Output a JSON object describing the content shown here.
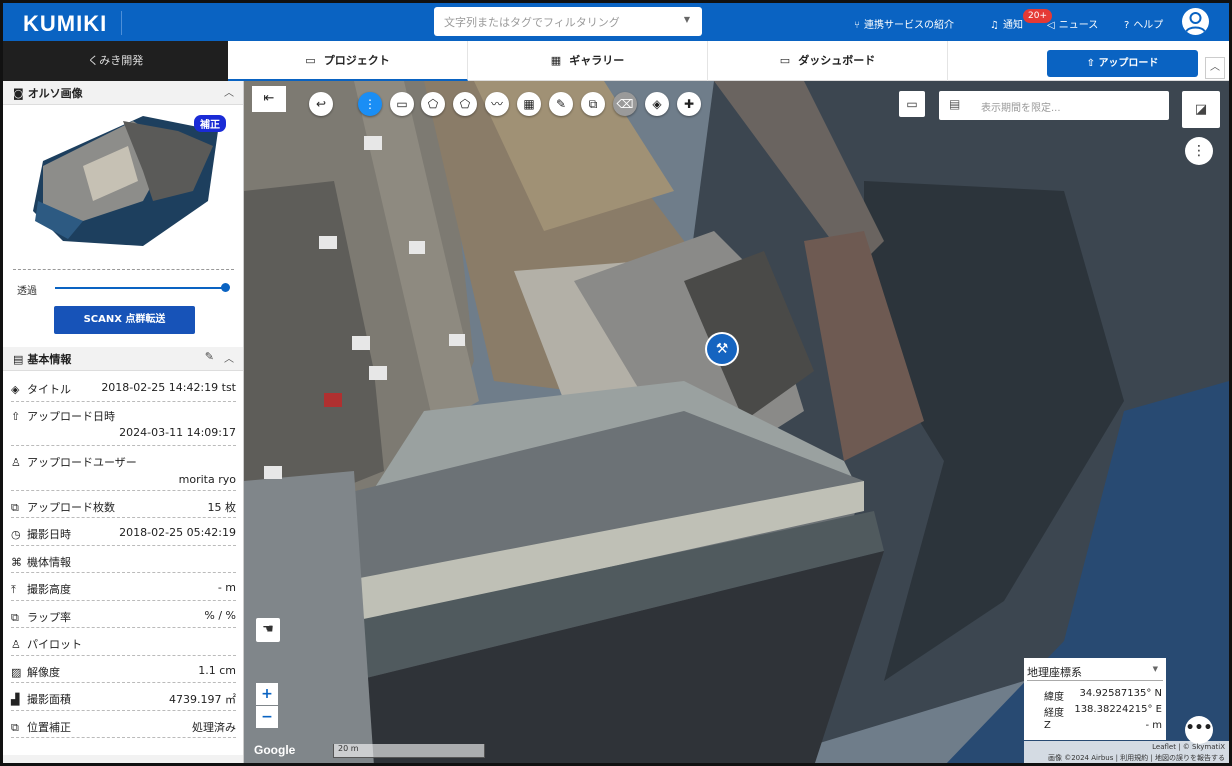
{
  "header": {
    "logo": "KUMIKI",
    "search_placeholder": "文字列またはタグでフィルタリング",
    "services": "連携サービスの紹介",
    "notifications": "通知",
    "notification_badge": "20+",
    "news": "ニュース",
    "help": "ヘルプ"
  },
  "tabs": {
    "team": "くみき開発",
    "project": "プロジェクト",
    "gallery": "ギャラリー",
    "dashboard": "ダッシュボード",
    "upload": "アップロード"
  },
  "sidebar": {
    "ortho_title": "オルソ画像",
    "corrected_badge": "補正",
    "opacity_label": "透過",
    "opacity_value": 1.0,
    "scanx_button": "SCANX 点群転送",
    "info_title": "基本情報",
    "rows": [
      {
        "label": "タイトル",
        "value": "2018-02-25 14:42:19 tst"
      },
      {
        "label": "アップロード日時",
        "value": "2024-03-11 14:09:17"
      },
      {
        "label": "アップロードユーザー",
        "value": "morita ryo"
      },
      {
        "label": "アップロード枚数",
        "value": "15 枚"
      },
      {
        "label": "撮影日時",
        "value": "2018-02-25 05:42:19"
      },
      {
        "label": "機体情報",
        "value": ""
      },
      {
        "label": "撮影高度",
        "value": "- m"
      },
      {
        "label": "ラップ率",
        "value": "% / %"
      },
      {
        "label": "パイロット",
        "value": ""
      },
      {
        "label": "解像度",
        "value": "1.1 cm"
      },
      {
        "label": "撮影面積",
        "value": "4739.197 ㎡"
      },
      {
        "label": "位置補正",
        "value": "処理済み"
      }
    ]
  },
  "map": {
    "date_placeholder": "表示期間を限定...",
    "coord_system": "地理座標系",
    "lat_label": "緯度",
    "lat_value": "34.92587135° N",
    "lon_label": "経度",
    "lon_value": "138.38224215° E",
    "z_label": "Z",
    "z_value": "- m",
    "zoom_in": "+",
    "zoom_out": "−",
    "google": "Google",
    "scale": "20 m",
    "attribution_1": "Leaflet | © SkymatiX",
    "attribution_2": "画像 ©2024 Airbus | 利用規約 | 地図の誤りを報告する"
  },
  "colors": {
    "brand": "#0a63c2",
    "badge": "#e53935"
  }
}
